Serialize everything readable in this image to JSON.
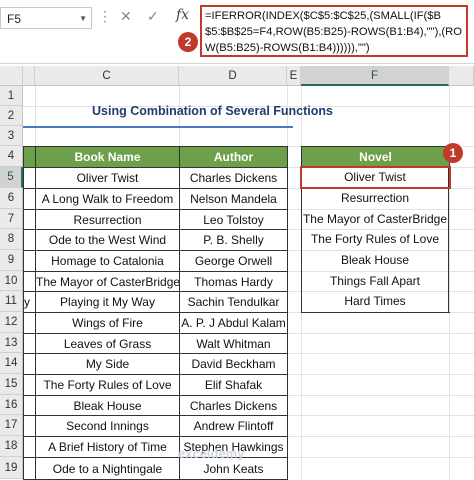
{
  "formula_bar": {
    "name_box": "F5",
    "formula": "=IFERROR(INDEX($C$5:$C$25,(SMALL(IF($B$5:$B$25=F4,ROW(B5:B25)-ROWS(B1:B4),\"\"),(ROW(B5:B25)-ROWS(B1:B4)))))),\"\")"
  },
  "badges": {
    "formula": "2",
    "cell": "1"
  },
  "columns": [
    "C",
    "D",
    "E",
    "F"
  ],
  "rows": [
    "1",
    "2",
    "3",
    "4",
    "5",
    "6",
    "7",
    "8",
    "9",
    "10",
    "11",
    "12",
    "13",
    "14",
    "15",
    "16",
    "17",
    "18",
    "19"
  ],
  "title": "Using Combination of Several Functions",
  "table": {
    "headers": [
      "Book Name",
      "Author"
    ],
    "rows": [
      [
        "Oliver Twist",
        "Charles Dickens"
      ],
      [
        "A Long Walk to Freedom",
        "Nelson Mandela"
      ],
      [
        "Resurrection",
        "Leo Tolstoy"
      ],
      [
        "Ode to the West Wind",
        "P. B. Shelly"
      ],
      [
        "Homage to Catalonia",
        "George Orwell"
      ],
      [
        "The Mayor of CasterBridge",
        "Thomas Hardy"
      ],
      [
        "Playing it My Way",
        "Sachin Tendulkar"
      ],
      [
        "Wings of Fire",
        "A. P. J Abdul Kalam"
      ],
      [
        "Leaves of Grass",
        "Walt Whitman"
      ],
      [
        "My Side",
        "David Beckham"
      ],
      [
        "The Forty Rules of Love",
        "Elif Shafak"
      ],
      [
        "Bleak House",
        "Charles Dickens"
      ],
      [
        "Second Innings",
        "Andrew Flintoff"
      ],
      [
        "A Brief History of Time",
        "Stephen Hawkings"
      ],
      [
        "Ode to a Nightingale",
        "John Keats"
      ]
    ]
  },
  "col_b_fragment": "y",
  "novel": {
    "header": "Novel",
    "items": [
      "Oliver Twist",
      "Resurrection",
      "The Mayor of CasterBridge",
      "The Forty Rules of Love",
      "Bleak House",
      "Things Fall Apart",
      "Hard Times"
    ]
  },
  "watermark": "exceldemy"
}
